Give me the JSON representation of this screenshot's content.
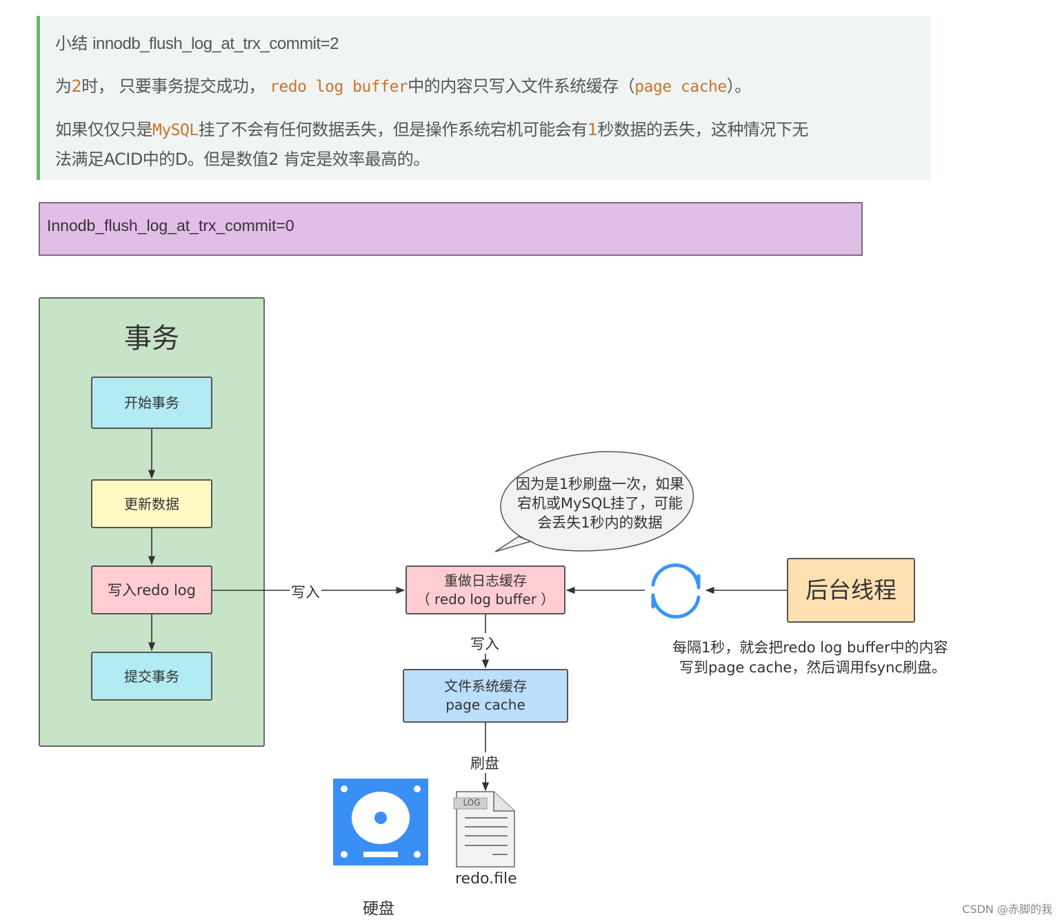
{
  "summary": {
    "title_prefix": "小结",
    "title_setting": "innodb_flush_log_at_trx_commit=2",
    "line2": {
      "part1": "为",
      "value": "2",
      "part2": "时， 只要事务提交成功，",
      "code1": "redo log buffer",
      "part3": "中的内容只写入文件系统缓存（",
      "code2": "page cache",
      "part4": "）。"
    },
    "line3": {
      "part1": "如果仅仅只是",
      "code": "MySQL",
      "part2": "挂了不会有任何数据丢失，但是操作系统宕机可能会有",
      "value": "1",
      "part3": "秒数据的丢失，这种情况下无"
    },
    "line4": "法满足ACID中的D。但是数值2 肯定是效率最高的。"
  },
  "section_header": "Innodb_flush_log_at_trx_commit=0",
  "diagram": {
    "group_title": "事务",
    "steps": [
      "开始事务",
      "更新数据",
      "写入redo log",
      "提交事务"
    ],
    "edge_write_label": "写入",
    "redo_buffer": {
      "line1": "重做日志缓存",
      "line2": "（ redo log buffer ）"
    },
    "edge_write_label2": "写入",
    "page_cache": {
      "line1": "文件系统缓存",
      "line2": "page cache"
    },
    "edge_flush_label": "刷盘",
    "bubble": [
      "因为是1秒刷盘一次，如果",
      "宕机或MySQL挂了，可能",
      "会丢失1秒内的数据"
    ],
    "background_thread": "后台线程",
    "note": [
      "每隔1秒，就会把redo log buffer中的内容",
      "写到page cache，然后调用fsync刷盘。"
    ],
    "disk_label": "硬盘",
    "file_tag": "LOG",
    "file_label": "redo.file",
    "colors": {
      "group": "#c8e4c8",
      "start": "#b2ebf2",
      "update": "#fff9c4",
      "write": "#ffcdd2",
      "commit": "#b2ebf2",
      "buffer": "#ffcdd2",
      "cache": "#bbdefb",
      "thread": "#ffe0b2",
      "accent_blue": "#3a94f5"
    }
  },
  "watermark": "CSDN @赤脚的我"
}
